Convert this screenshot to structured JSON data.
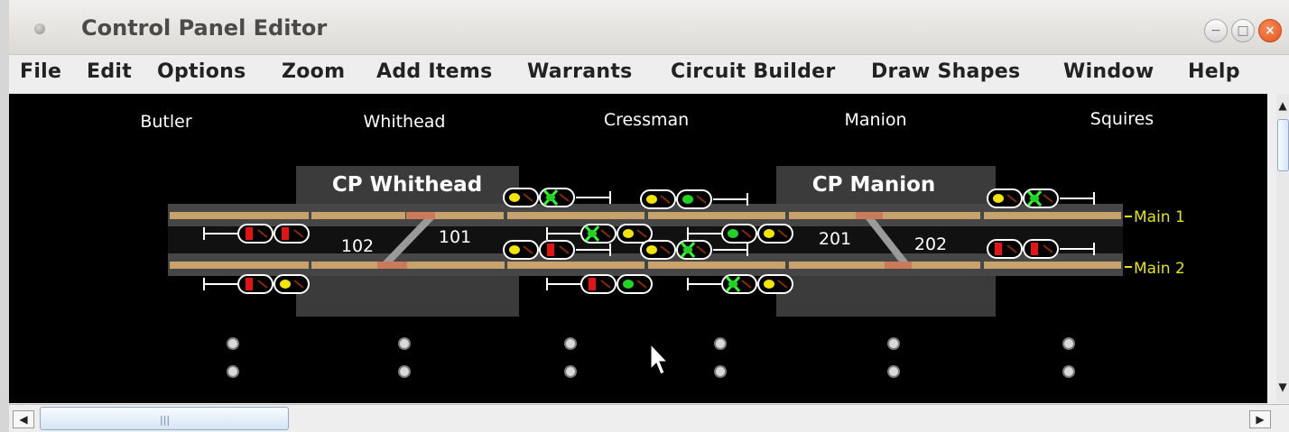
{
  "window": {
    "title": "Control Panel Editor",
    "controls": {
      "minimize": "−",
      "maximize": "□",
      "close": "×"
    }
  },
  "menubar": {
    "items": [
      {
        "label": "File"
      },
      {
        "label": "Edit"
      },
      {
        "label": "Options"
      },
      {
        "label": "Zoom"
      },
      {
        "label": "Add Items"
      },
      {
        "label": "Warrants"
      },
      {
        "label": "Circuit Builder"
      },
      {
        "label": "Draw Shapes"
      },
      {
        "label": "Window"
      },
      {
        "label": "Help"
      }
    ]
  },
  "panel": {
    "stations": [
      "Butler",
      "Whithead",
      "Cressman",
      "Manion",
      "Squires"
    ],
    "control_points": [
      {
        "name": "CP Whithead",
        "switches": [
          "102",
          "101"
        ]
      },
      {
        "name": "CP Manion",
        "switches": [
          "201",
          "202"
        ]
      }
    ],
    "tracks": [
      "Main 1",
      "Main 2"
    ],
    "colors": {
      "track": "#c8a26c",
      "track_bed": "#464646",
      "cp_box": "#3b3b3b",
      "track_label": "#e6e600",
      "signal_red": "#e21515",
      "signal_yellow": "#f2e600",
      "signal_green": "#22d422",
      "flash_green": "#2dff2d"
    }
  },
  "scrollbar": {
    "grip": "|||",
    "left_arrow": "◀",
    "right_arrow": "▶",
    "up_arrow": "▲",
    "down_arrow": "▼"
  }
}
